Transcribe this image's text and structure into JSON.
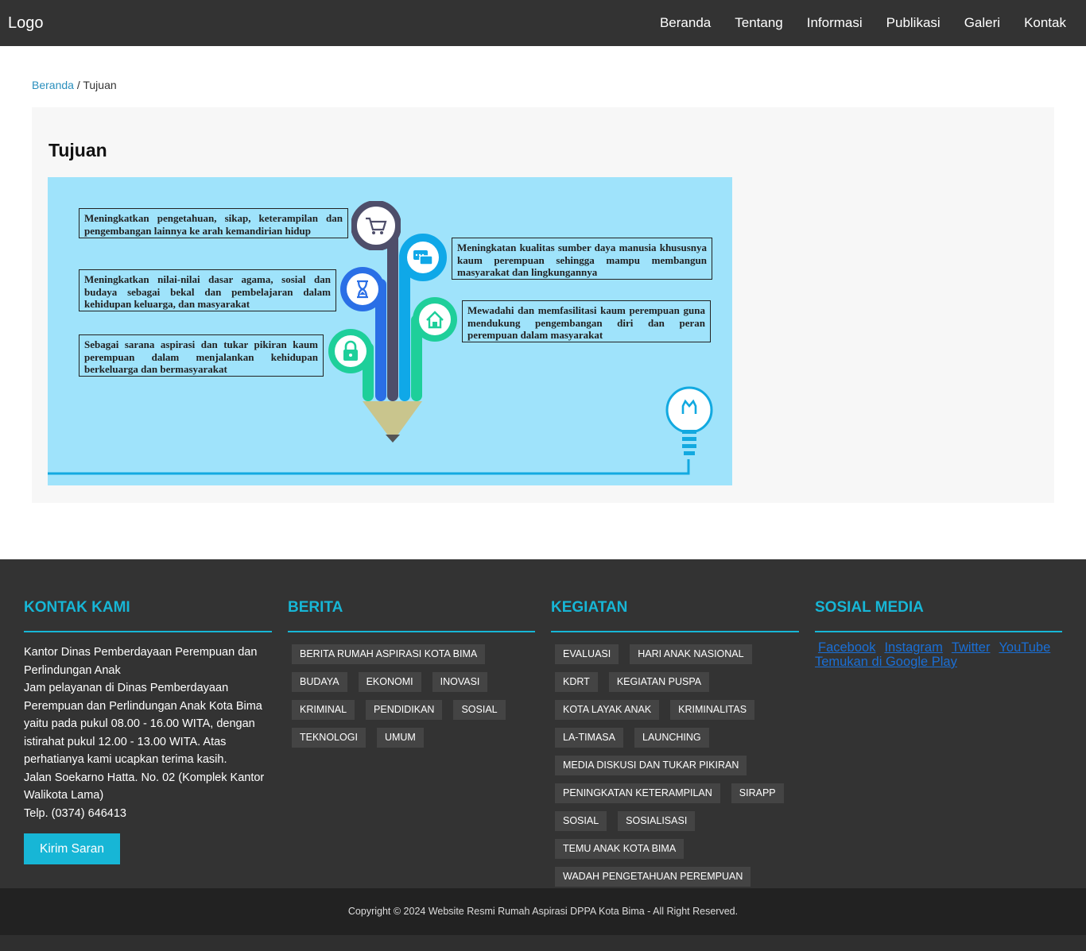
{
  "navbar": {
    "logo": "Logo",
    "items": [
      "Beranda",
      "Tentang",
      "Informasi",
      "Publikasi",
      "Galeri",
      "Kontak"
    ]
  },
  "breadcrumb": {
    "home": "Beranda",
    "separator": " / ",
    "current": "Tujuan"
  },
  "page": {
    "title": "Tujuan",
    "goals": [
      "Meningkatkan pengetahuan, sikap, keterampilan dan pengembangan lainnya ke arah kemandirian hidup",
      "Meningkatkan nilai-nilai dasar agama, sosial dan budaya sebagai bekal dan pembelajaran dalam kehidupan keluarga, dan masyarakat",
      "Sebagai sarana aspirasi dan tukar pikiran kaum perempuan dalam menjalankan kehidupan berkeluarga dan bermasyarakat",
      "Meningkatan kualitas sumber daya manusia khususnya kaum perempuan sehingga mampu membangun masyarakat dan lingkungannya",
      "Mewadahi dan memfasilitasi kaum perempuan guna mendukung pengembangan diri dan peran perempuan dalam masyarakat"
    ],
    "infographic_icons": [
      "cart-icon",
      "chat-icon",
      "hourglass-icon",
      "home-icon",
      "lock-icon",
      "lightbulb-icon"
    ]
  },
  "footer": {
    "kontak": {
      "title": "KONTAK KAMI",
      "lines": [
        "Kantor Dinas Pemberdayaan Perempuan dan Perlindungan Anak",
        "Jam pelayanan di Dinas Pemberdayaan Perempuan dan Perlindungan Anak Kota Bima yaitu pada pukul 08.00 - 16.00 WITA, dengan istirahat pukul 12.00 - 13.00 WITA. Atas perhatianya kami ucapkan terima kasih.",
        "Jalan Soekarno Hatta. No. 02 (Komplek Kantor Walikota Lama)",
        "Telp. (0374) 646413"
      ],
      "button": "Kirim Saran"
    },
    "berita": {
      "title": "BERITA",
      "tags": [
        "BERITA RUMAH ASPIRASI KOTA BIMA",
        "BUDAYA",
        "EKONOMI",
        "INOVASI",
        "KRIMINAL",
        "PENDIDIKAN",
        "SOSIAL",
        "TEKNOLOGI",
        "UMUM"
      ]
    },
    "kegiatan": {
      "title": "KEGIATAN",
      "tags": [
        "EVALUASI",
        "HARI ANAK NASIONAL",
        "KDRT",
        "KEGIATAN PUSPA",
        "KOTA LAYAK ANAK",
        "KRIMINALITAS",
        "LA-TIMASA",
        "LAUNCHING",
        "MEDIA DISKUSI DAN TUKAR PIKIRAN",
        "PENINGKATAN KETERAMPILAN",
        "SIRAPP",
        "SOSIAL",
        "SOSIALISASI",
        "TEMU ANAK KOTA BIMA",
        "WADAH PENGETAHUAN PEREMPUAN"
      ]
    },
    "sosial": {
      "title": "SOSIAL MEDIA",
      "links": [
        "Facebook",
        "Instagram",
        "Twitter",
        "YouTube"
      ],
      "google_play": "Temukan di Google Play"
    },
    "copyright": "Copyright © 2024 Website Resmi Rumah Aspirasi DPPA Kota Bima - All Right Reserved."
  },
  "colors": {
    "navbar": "#333333",
    "accent": "#17b6d6",
    "link": "#2a8fbd",
    "infographic_bg": "#9fe3fb",
    "footer": "#333333",
    "copyright_bar": "#222222"
  }
}
